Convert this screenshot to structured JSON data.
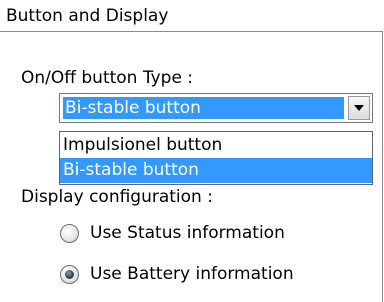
{
  "group": {
    "title": "Button and Display"
  },
  "onoff": {
    "label": "On/Off button Type :",
    "selected": "Bi-stable button",
    "options": [
      "Impulsionel button",
      "Bi-stable button"
    ],
    "highlighted_index": 1
  },
  "display": {
    "label": "Display configuration :",
    "options": [
      {
        "label": "Use Status information",
        "checked": false
      },
      {
        "label": "Use Battery information",
        "checked": true
      }
    ]
  },
  "colors": {
    "selection": "#3399ff",
    "border": "#7a7a7a"
  }
}
